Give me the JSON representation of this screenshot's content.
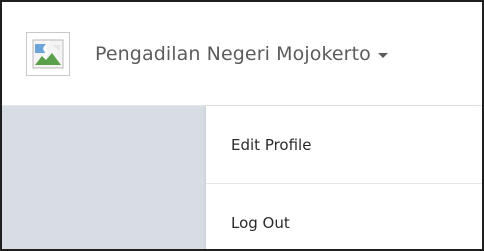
{
  "header": {
    "user_name": "Pengadilan Negeri Mojokerto",
    "avatar_icon": "broken-image-icon",
    "caret_icon": "caret-down-icon"
  },
  "dropdown": {
    "items": [
      {
        "label": "Edit Profile"
      },
      {
        "label": "Log Out"
      }
    ]
  },
  "colors": {
    "side_panel": "#d8dde4",
    "text": "#5c5c5c"
  }
}
